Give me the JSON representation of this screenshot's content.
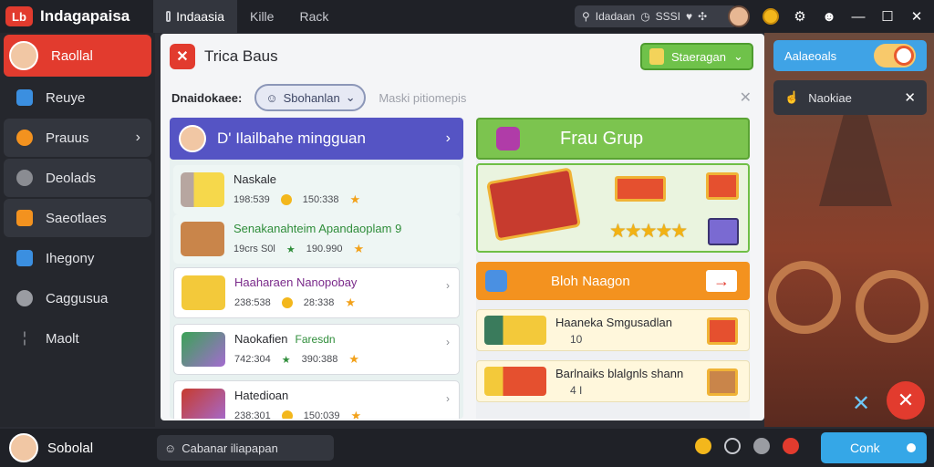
{
  "app": {
    "logo": "Lb",
    "title": "Indagapaisa"
  },
  "tabs": [
    {
      "label": "Indaasia",
      "active": true
    },
    {
      "label": "Kille",
      "active": false
    },
    {
      "label": "Rack",
      "active": false
    }
  ],
  "topbar": {
    "search_text": "Idadaan",
    "search_count": "SSSI"
  },
  "sidebar": {
    "items": [
      {
        "label": "Raollal",
        "icon": "avatar",
        "active": true
      },
      {
        "label": "Reuye",
        "icon": "chart-icon"
      },
      {
        "label": "Prauus",
        "icon": "orange-dot-icon",
        "chevron": true
      },
      {
        "label": "Deolads",
        "icon": "people-icon"
      },
      {
        "label": "Saeotlaes",
        "icon": "box-icon"
      },
      {
        "label": "Ihegony",
        "icon": "doc-icon"
      },
      {
        "label": "Caggusua",
        "icon": "shield-icon"
      },
      {
        "label": "Maolt",
        "icon": "info-icon"
      }
    ]
  },
  "panel": {
    "logo": "✕",
    "title": "Trica Baus",
    "action_label": "Staeragan",
    "filter_label": "Dnaidokaee:",
    "filter_value": "Sbohanlan",
    "filter_placeholder": "Maski pitiomepis"
  },
  "weekly": {
    "title": "D' Ilailbahe mingguan"
  },
  "cards": [
    {
      "title": "Naskale",
      "code": "198:539",
      "value": "150:338",
      "style": "plain"
    },
    {
      "title": "Senakanahteim Apandaoplam 9",
      "code": "19crs S0l",
      "value": "190.990",
      "style": "green"
    },
    {
      "title": "Haaharaen Nanopobay",
      "code": "238:538",
      "value": "28:338",
      "style": "purple"
    },
    {
      "title": "Naokafien",
      "code": "742:304",
      "value": "390:388",
      "extra": "Faresdn",
      "style": "plain"
    },
    {
      "title": "Hatedioan",
      "code": "238:301",
      "value": "150:039",
      "style": "plain"
    }
  ],
  "right": {
    "group_label": "Frau Grup",
    "stars": "★★★★★",
    "shop_label": "Bloh Naagon",
    "rewards": [
      {
        "title": "Haaneka Smgusadlan",
        "count": "10"
      },
      {
        "title": "Barlnaiks blalgnls shann",
        "count": "4 I"
      }
    ]
  },
  "notifications": [
    {
      "label": "Aalaeoals"
    },
    {
      "label": "Naokiae"
    }
  ],
  "bottombar": {
    "user_label": "Sobolal",
    "input_text": "Cabanar iliapapan",
    "cta_label": "Conk"
  },
  "colors": {
    "accent_red": "#e23b2e",
    "weekly_purple": "#5554c4",
    "group_green": "#7cc44f",
    "shop_orange": "#f3921f",
    "cta_blue": "#35a7e7"
  }
}
